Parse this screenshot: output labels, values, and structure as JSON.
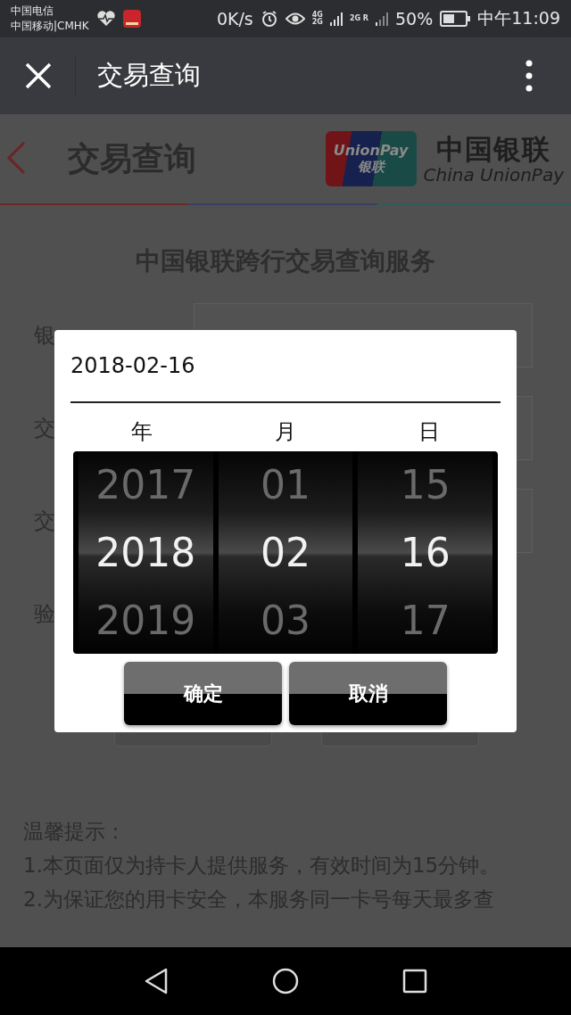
{
  "status_bar": {
    "carriers": [
      "中国电信",
      "中国移动|CMHK"
    ],
    "speed": "0K/s",
    "sim1_network": [
      "4G",
      "2G"
    ],
    "sim2_network": "2G R",
    "battery": "50%",
    "time": "中午11:09"
  },
  "title_bar": {
    "title": "交易查询"
  },
  "header": {
    "title": "交易查询",
    "logo_card": [
      "UnionPay",
      "银联"
    ],
    "logo_name": "中国银联",
    "logo_english": "China UnionPay"
  },
  "heading": "中国银联跨行交易查询服务",
  "form_labels": [
    "银",
    "交",
    "交",
    "验"
  ],
  "dialog": {
    "value": "2018-02-16",
    "columns": [
      {
        "header": "年",
        "items": [
          {
            "text": "2017",
            "selected": false
          },
          {
            "text": "2018",
            "selected": true
          },
          {
            "text": "2019",
            "selected": false
          }
        ]
      },
      {
        "header": "月",
        "items": [
          {
            "text": "01",
            "selected": false
          },
          {
            "text": "02",
            "selected": true
          },
          {
            "text": "03",
            "selected": false
          }
        ]
      },
      {
        "header": "日",
        "items": [
          {
            "text": "15",
            "selected": false
          },
          {
            "text": "16",
            "selected": true
          },
          {
            "text": "17",
            "selected": false
          }
        ]
      }
    ],
    "buttons": [
      "确定",
      "取消"
    ]
  },
  "tips": [
    "温馨提示：",
    "1.本页面仅为持卡人提供服务，有效时间为15分钟。",
    "2.为保证您的用卡安全，本服务同一卡号每天最多查"
  ]
}
